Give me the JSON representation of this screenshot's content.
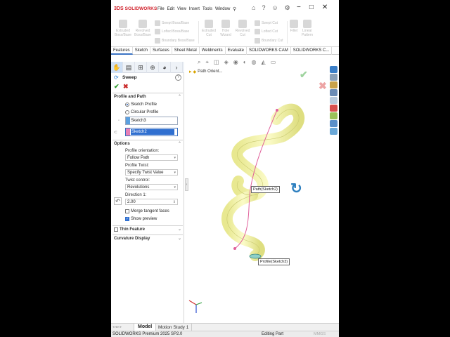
{
  "app": {
    "brand": "SOLIDWORKS",
    "brand_mark": "3DS",
    "menus": [
      "File",
      "Edit",
      "View",
      "Insert",
      "Tools",
      "Window"
    ]
  },
  "ribbon": {
    "extruded_boss": "Extruded Boss/Base",
    "revolved_boss": "Revolved Boss/Base",
    "swept_boss": "Swept Boss/Base",
    "lofted_boss": "Lofted Boss/Base",
    "boundary_boss": "Boundary Boss/Base",
    "extruded_cut": "Extruded Cut",
    "hole_wizard": "Hole Wizard",
    "revolved_cut": "Revolved Cut",
    "swept_cut": "Swept Cut",
    "lofted_cut": "Lofted Cut",
    "boundary_cut": "Boundary Cut",
    "fillet": "Fillet",
    "linear_pattern": "Linear Pattern"
  },
  "tabs": [
    "Features",
    "Sketch",
    "Surfaces",
    "Sheet Metal",
    "Weldments",
    "Evaluate",
    "SOLIDWORKS CAM",
    "SOLIDWORKS C..."
  ],
  "pm": {
    "title": "Sweep",
    "help": "?",
    "profile_section": "Profile and Path",
    "opt_sketch_profile": "Sketch Profile",
    "opt_circular_profile": "Circular Profile",
    "profile_value": "Sketch3",
    "path_value": "Sketch2",
    "options_section": "Options",
    "profile_orientation_label": "Profile orientation:",
    "profile_orientation_value": "Follow Path",
    "profile_twist_label": "Profile Twist:",
    "profile_twist_value": "Specify Twist Value",
    "twist_control_label": "Twist control:",
    "twist_control_value": "Revolutions",
    "direction_label": "Direction 1:",
    "direction_value": "2.00",
    "merge_tangent": "Merge tangent faces",
    "show_preview": "Show preview",
    "thin_feature": "Thin Feature",
    "curvature_display": "Curvature Display"
  },
  "viewport": {
    "path_orient": "Path Orient...",
    "callout_path": "Path(Sketch2)",
    "callout_profile": "Profile(Sketch3)"
  },
  "bottom": {
    "tab_model": "Model",
    "tab_motion": "Motion Study 1"
  },
  "status": {
    "version": "SOLIDWORKS Premium 2025 SP2.0",
    "mode": "Editing Part",
    "units": "MMGS"
  },
  "colors": {
    "accent": "#2f6fd0",
    "brand": "#d0202a",
    "sweep_body": "#f4f4a8",
    "path_line": "#e0609a",
    "profile_swatch": "#e77fb6",
    "path_swatch": "#5aa0e0"
  }
}
